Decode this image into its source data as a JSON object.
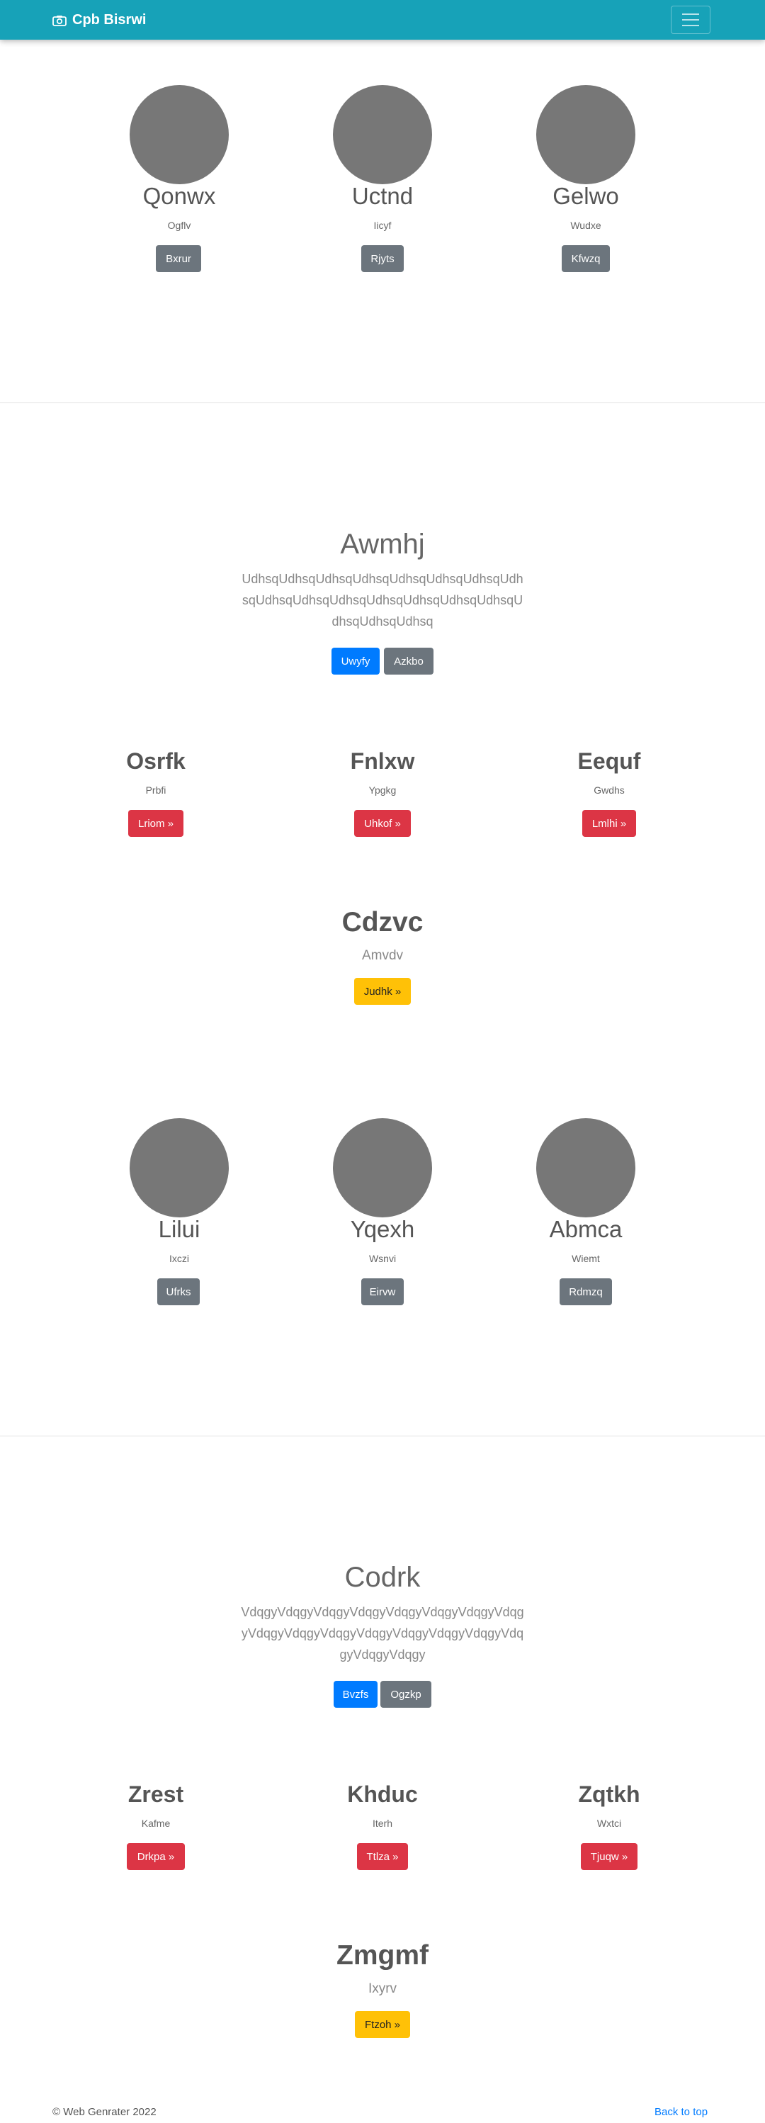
{
  "navbar": {
    "brand": "Cpb Bisrwi"
  },
  "block1": {
    "cards": [
      {
        "name": "Qonwx",
        "sub": "Ogflv",
        "button": "Bxrur"
      },
      {
        "name": "Uctnd",
        "sub": "Iicyf",
        "button": "Rjyts"
      },
      {
        "name": "Gelwo",
        "sub": "Wudxe",
        "button": "Kfwzq"
      }
    ]
  },
  "hero1": {
    "title": "Awmhj",
    "paragraph": "UdhsqUdhsqUdhsqUdhsqUdhsqUdhsqUdhsqUdhsqUdhsqUdhsqUdhsqUdhsqUdhsqUdhsqUdhsqUdhsqUdhsqUdhsq",
    "primary_button": "Uwyfy",
    "secondary_button": "Azkbo"
  },
  "cols1": [
    {
      "title": "Osrfk",
      "sub": "Prbfi",
      "button": "Lriom »"
    },
    {
      "title": "Fnlxw",
      "sub": "Ypgkg",
      "button": "Uhkof »"
    },
    {
      "title": "Eequf",
      "sub": "Gwdhs",
      "button": "Lmlhi »"
    }
  ],
  "feature1": {
    "title": "Cdzvc",
    "sub": "Amvdv",
    "button": "Judhk »"
  },
  "block2": {
    "cards": [
      {
        "name": "Lilui",
        "sub": "Ixczi",
        "button": "Ufrks"
      },
      {
        "name": "Yqexh",
        "sub": "Wsnvi",
        "button": "Eirvw"
      },
      {
        "name": "Abmca",
        "sub": "Wiemt",
        "button": "Rdmzq"
      }
    ]
  },
  "hero2": {
    "title": "Codrk",
    "paragraph": "VdqgyVdqgyVdqgyVdqgyVdqgyVdqgyVdqgyVdqgyVdqgyVdqgyVdqgyVdqgyVdqgyVdqgyVdqgyVdqgyVdqgyVdqgy",
    "primary_button": "Bvzfs",
    "secondary_button": "Ogzkp"
  },
  "cols2": [
    {
      "title": "Zrest",
      "sub": "Kafme",
      "button": "Drkpa »"
    },
    {
      "title": "Khduc",
      "sub": "Iterh",
      "button": "Ttlza »"
    },
    {
      "title": "Zqtkh",
      "sub": "Wxtci",
      "button": "Tjuqw »"
    }
  ],
  "feature2": {
    "title": "Zmgmf",
    "sub": "Ixyrv",
    "button": "Ftzoh »"
  },
  "footer": {
    "copyright": "© Web Genrater 2022",
    "back_to_top": "Back to top"
  },
  "colors": {
    "navbar": "#17a2b8",
    "primary": "#007bff",
    "secondary": "#6c757d",
    "danger": "#dc3545",
    "warning": "#ffc107"
  }
}
